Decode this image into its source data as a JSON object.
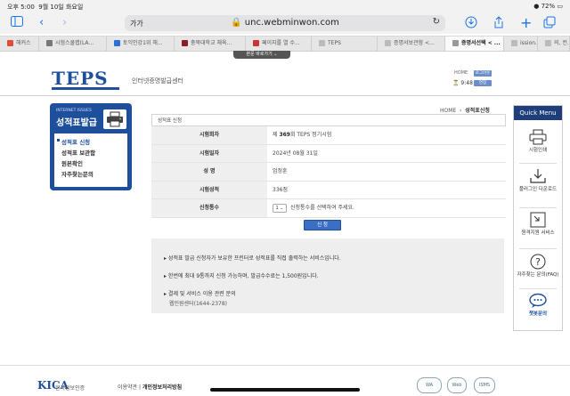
{
  "status_bar": {
    "time": "오후 5:00",
    "date": "9월 10일 화요일",
    "battery": "72%"
  },
  "browser": {
    "address_aa": "가가",
    "url": "unc.webminwon.com",
    "tabs": [
      {
        "label": "해커스",
        "color": "#e34b3a"
      },
      {
        "label": "시험스쿨랩(LA...",
        "color": "#777777"
      },
      {
        "label": "토익인강1위 해...",
        "color": "#2d6fd6"
      },
      {
        "label": "충북대학교 체육...",
        "color": "#8a1d2a"
      },
      {
        "label": "페이지를 열 수...",
        "color": "#c33"
      },
      {
        "label": "TEPS",
        "color": "#bbbbbb"
      },
      {
        "label": "증명서보관함 <...",
        "color": "#bbbbbb"
      },
      {
        "label": "증명서선택 < ...",
        "color": "#999999",
        "active": true
      },
      {
        "label": "ission.s...",
        "color": "#bbbbbb"
      },
      {
        "label": "의, 컨...",
        "color": "#bbbbbb"
      }
    ],
    "float_button": "본문 바로가기 ⌄"
  },
  "header": {
    "logo": "TEPS",
    "site_title": "인터넷증명발급센터",
    "home_link": "HOME",
    "btn_logout": "로그아웃",
    "btn_extend": "연장",
    "timer": "9:48"
  },
  "breadcrumb": {
    "home": "HOME",
    "sep": "›",
    "current": "성적표신청"
  },
  "leftnav": {
    "subtitle": "INTERNET ISSUES",
    "title": "성적표발급",
    "items": [
      {
        "label": "성적표 신청",
        "active": true
      },
      {
        "label": "성적표 보관함"
      },
      {
        "label": "원본확인"
      },
      {
        "label": "자주찾는문의"
      }
    ]
  },
  "form": {
    "header": "성적표 신청",
    "rows": [
      {
        "label": "시험회차",
        "prefix": "제 ",
        "bold": "369",
        "suffix": "회 TEPS 정기시험"
      },
      {
        "label": "시험일자",
        "value": "2024년 08월 31일"
      },
      {
        "label": "성 명",
        "value": "엄정훈"
      },
      {
        "label": "시험성적",
        "value": "336점"
      },
      {
        "label": "신청통수",
        "select": "1",
        "hint": "신청통수를 선택하여 주세요."
      }
    ],
    "submit": "신 청"
  },
  "info": {
    "lines": [
      "성적표 발급 신청자가 보유한 프린터로 성적표를 직접 출력하는 서비스입니다.",
      "한번에 최대 9통까지 신청 가능하며, 발급수수료는 1,500원입니다.",
      "결제 및 서비스 이용 관련 문의"
    ],
    "contact": "웹민원센터(1644-2378)"
  },
  "quick_menu": {
    "title": "Quick Menu",
    "items": [
      {
        "icon": "printer-icon",
        "label": "시험인쇄"
      },
      {
        "icon": "download-icon",
        "label": "플러그인 다운로드"
      },
      {
        "icon": "remote-support-icon",
        "label": "원격지원 서비스"
      },
      {
        "icon": "faq-icon",
        "label": "자주찾는 문의(FAQ)"
      },
      {
        "icon": "chatbot-icon",
        "label": "챗봇문의"
      }
    ]
  },
  "footer": {
    "brand": "KICA",
    "brand_sub": "한국정보인증",
    "terms": "이용약관",
    "privacy": "개인정보처리방침",
    "seals": [
      "WA",
      "Web",
      "ISMS"
    ]
  }
}
